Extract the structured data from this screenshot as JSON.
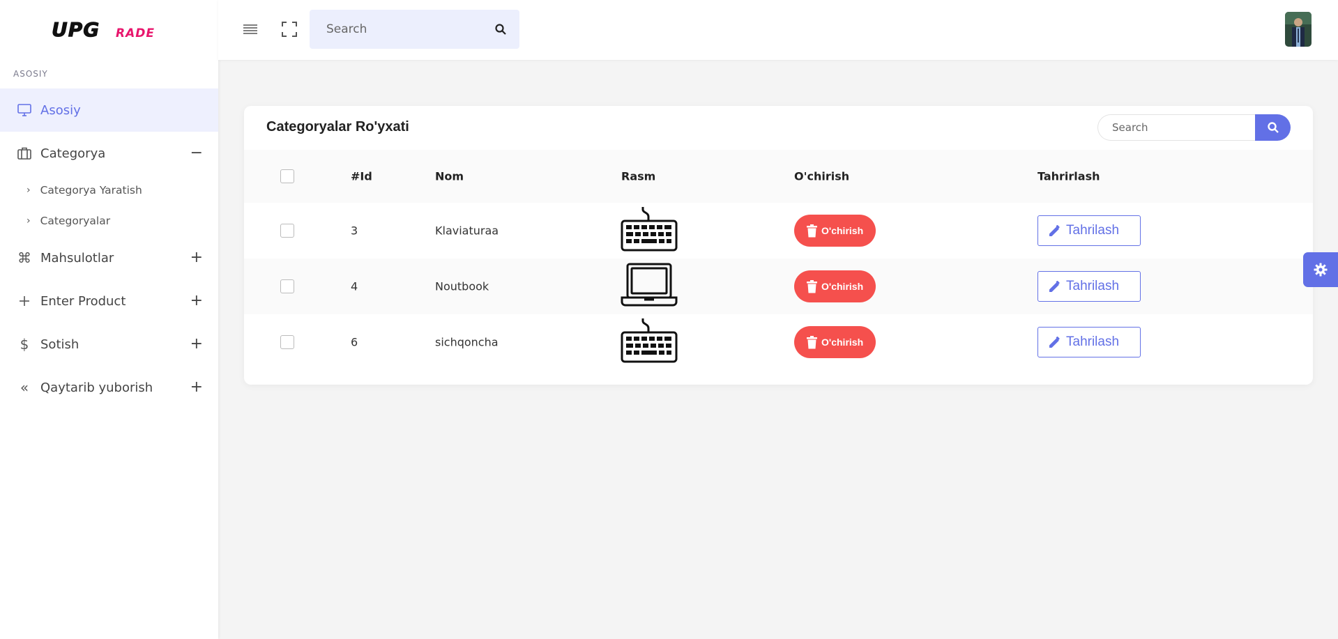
{
  "app": {
    "logo_text": "UPGRADE",
    "logo_main": "UPG",
    "logo_accent": "RADE",
    "accent_color": "#6270e6",
    "logo_accent_color": "#e8156c"
  },
  "sidebar": {
    "section_label": "ASOSIY",
    "items": [
      {
        "label": "Asosiy",
        "icon": "monitor-icon",
        "active": true,
        "toggle": ""
      },
      {
        "label": "Categorya",
        "icon": "briefcase-icon",
        "active": false,
        "toggle": "−"
      },
      {
        "label": "Mahsulotlar",
        "icon": "command-icon",
        "active": false,
        "toggle": "+"
      },
      {
        "label": "Enter Product",
        "icon": "plus-icon",
        "active": false,
        "toggle": "+"
      },
      {
        "label": "Sotish",
        "icon": "dollar-icon",
        "active": false,
        "toggle": "+"
      },
      {
        "label": "Qaytarib yuborish",
        "icon": "double-chevron-left-icon",
        "active": false,
        "toggle": "+"
      }
    ],
    "subitems": [
      {
        "label": "Categorya Yaratish"
      },
      {
        "label": "Categoryalar"
      }
    ]
  },
  "topbar": {
    "search_placeholder": "Search",
    "icons": [
      "menu-icon",
      "fullscreen-icon",
      "search-icon"
    ]
  },
  "card": {
    "title": "Categoryalar Ro'yxati",
    "search_placeholder": "Search"
  },
  "table": {
    "columns": [
      "#Id",
      "Nom",
      "Rasm",
      "O'chirish",
      "Tahrirlash"
    ],
    "rows": [
      {
        "id": "3",
        "name": "Klaviaturaa",
        "image": "keyboard-icon",
        "delete_label": "O'chirish",
        "edit_label": "Tahrilash"
      },
      {
        "id": "4",
        "name": "Noutbook",
        "image": "laptop-icon",
        "delete_label": "O'chirish",
        "edit_label": "Tahrilash"
      },
      {
        "id": "6",
        "name": "sichqoncha",
        "image": "keyboard-icon",
        "delete_label": "O'chirish",
        "edit_label": "Tahrilash"
      }
    ]
  },
  "colors": {
    "delete": "#f5504d",
    "edit": "#6270e6",
    "active_bg": "#eef0fe"
  }
}
